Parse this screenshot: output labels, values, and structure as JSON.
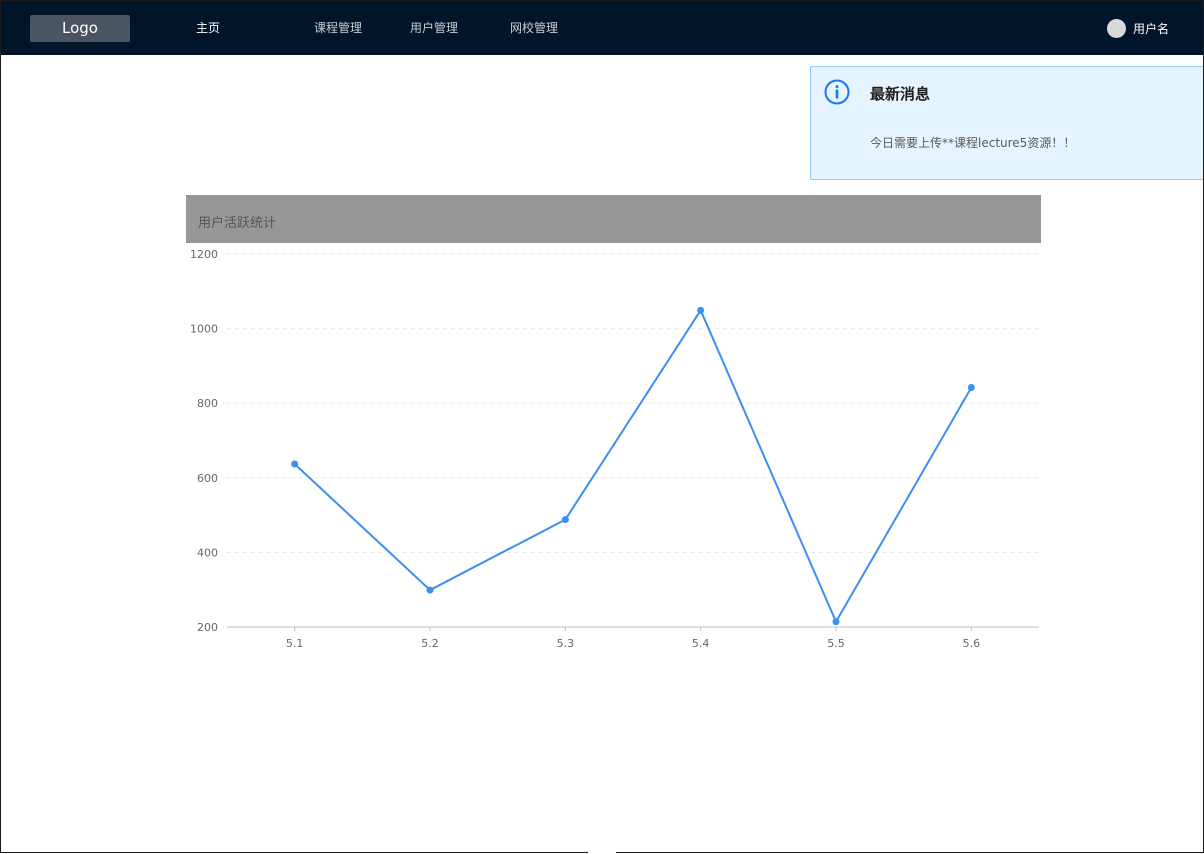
{
  "nav": {
    "logo": "Logo",
    "items": [
      {
        "label": "主页",
        "active": true
      },
      {
        "label": "课程管理",
        "active": false
      },
      {
        "label": "用户管理",
        "active": false
      },
      {
        "label": "网校管理",
        "active": false
      }
    ],
    "username": "用户名"
  },
  "notice": {
    "icon": "info-circle-icon",
    "title": "最新消息",
    "message": "今日需要上传**课程lecture5资源！！"
  },
  "chart_card": {
    "title": "用户活跃统计"
  },
  "chart_data": {
    "type": "line",
    "categories": [
      "5.1",
      "5.2",
      "5.3",
      "5.4",
      "5.5",
      "5.6"
    ],
    "series": [
      {
        "values": [
          637,
          299,
          488,
          1049,
          214,
          842
        ]
      }
    ],
    "ylim": [
      200,
      1200
    ],
    "yticks": [
      200,
      400,
      600,
      800,
      1000,
      1200
    ],
    "grid": true,
    "color": "#3b8ff3"
  },
  "colors": {
    "topbar": "#001529",
    "accent": "#1677ff",
    "notice_bg": "#e6f4ff",
    "line": "#3b8ff3"
  }
}
